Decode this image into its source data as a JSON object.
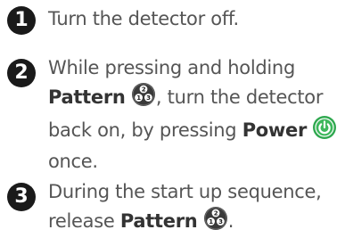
{
  "steps": [
    {
      "number": "1",
      "text": "Turn the detector off."
    },
    {
      "number": "2",
      "text_a": "While pressing and holding",
      "pattern_label": "Pattern",
      "text_b": ", turn the detector back on, by pressing",
      "power_label": "Power",
      "text_c": "once."
    },
    {
      "number": "3",
      "text_a": "During the start up sequence, release",
      "pattern_label": "Pattern",
      "text_b": "."
    }
  ],
  "icons": {
    "pattern_button": "pattern-button-icon",
    "power_button": "power-button-icon"
  },
  "colors": {
    "text": "#555555",
    "step_badge": "#1a1a1a",
    "power_green": "#2fa84f",
    "pattern_dark": "#3a3a3a"
  }
}
